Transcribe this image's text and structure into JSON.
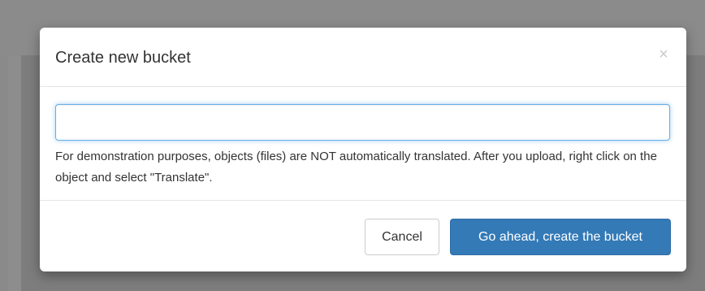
{
  "modal": {
    "title": "Create new bucket",
    "close_glyph": "×",
    "close_icon": "close-icon"
  },
  "form": {
    "bucket_name_value": "",
    "bucket_name_placeholder": "",
    "help_text": "For demonstration purposes, objects (files) are NOT automatically translated. After you upload, right click on the object and select \"Translate\"."
  },
  "footer": {
    "cancel_label": "Cancel",
    "confirm_label": "Go ahead, create the bucket"
  },
  "colors": {
    "primary": "#337ab7",
    "input_focus_border": "#66afe9",
    "backdrop": "#808080"
  }
}
